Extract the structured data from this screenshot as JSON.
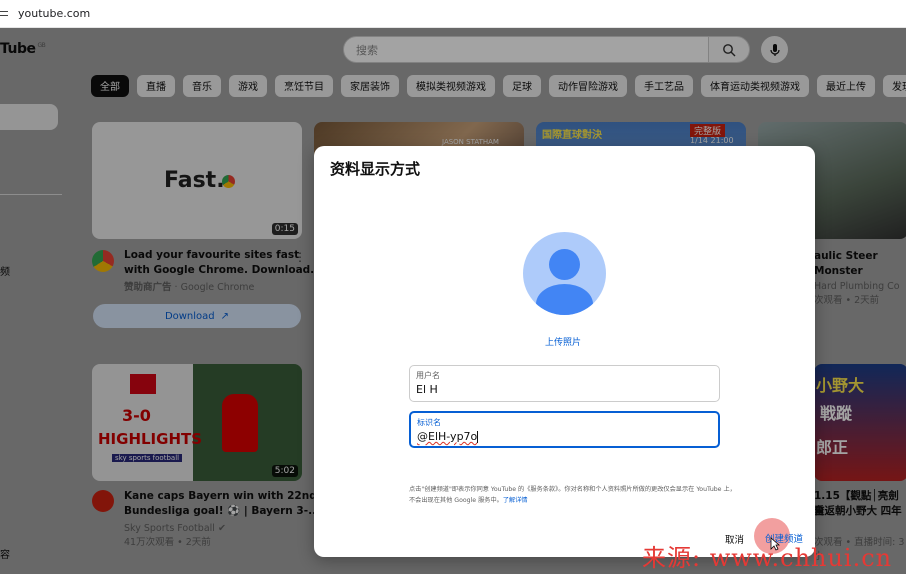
{
  "browser": {
    "url": "youtube.com"
  },
  "header": {
    "logo_text": "Tube",
    "region": "GB",
    "search_placeholder": "搜索"
  },
  "sidebar": {
    "item_a": "频",
    "item_b": "容"
  },
  "chips": [
    "全部",
    "直播",
    "音乐",
    "游戏",
    "烹饪节目",
    "家居装饰",
    "模拟类视频游戏",
    "足球",
    "动作冒险游戏",
    "手工艺品",
    "体育运动类视频游戏",
    "最近上传",
    "发现新视频"
  ],
  "videos": {
    "ad": {
      "thumb_text": "Fast.",
      "duration": "0:15",
      "title_line1": "Load your favourite sites fast",
      "title_line2": "with Google Chrome. Download...",
      "meta_sponsor": "赞助商广告",
      "meta_channel": "· Google Chrome",
      "download_label": "Download"
    },
    "v2": {
      "thumb_text": "JASON STATHAM"
    },
    "v3": {
      "thumb_text_1": "国際直球對決",
      "thumb_badge": "完整版",
      "thumb_date": "1/14 21:00"
    },
    "v4": {
      "title": "aulic Steer Monster",
      "channel": "Hard Plumbing Co",
      "meta": "次观看 • 2天前"
    },
    "bayern": {
      "score": "3-0",
      "highlights": "HIGHLIGHTS",
      "brand": "sky sports football",
      "duration": "5:02",
      "title_line1": "Kane caps Bayern win with 22nd",
      "title_line2": "Bundesliga goal! ⚽ | Bayern 3-...",
      "channel": "Sky Sports Football",
      "meta": "41万次观看 • 2天前"
    },
    "v6": {
      "thumb_text_1": "小野大",
      "thumb_text_2": "戦蹤",
      "thumb_text_3": "郎正",
      "title_line1": "1.15【觀點│亮劍台",
      "title_line2": "重返朝小野大 四年",
      "meta": "次观看 • 直播时间: 3小"
    }
  },
  "modal": {
    "title": "资料显示方式",
    "upload_label": "上传照片",
    "username_label": "用户名",
    "username_value": "El H",
    "handle_label": "标识名",
    "handle_value": "@ElH-yp7o",
    "legal_text": "点击\"创建频道\"即表示你同意 YouTube 的《服务条款》。你对名称和个人资料照片所做的更改仅会显示在 YouTube 上，不会出现在其他 Google 服务中。",
    "legal_link": "了解详情",
    "cancel_label": "取消",
    "create_label": "创建频道"
  },
  "watermark": "来源: www.chhui.cn",
  "colors": {
    "accent": "#065fd4",
    "ripple": "#e85050",
    "watermark": "#e53935"
  }
}
